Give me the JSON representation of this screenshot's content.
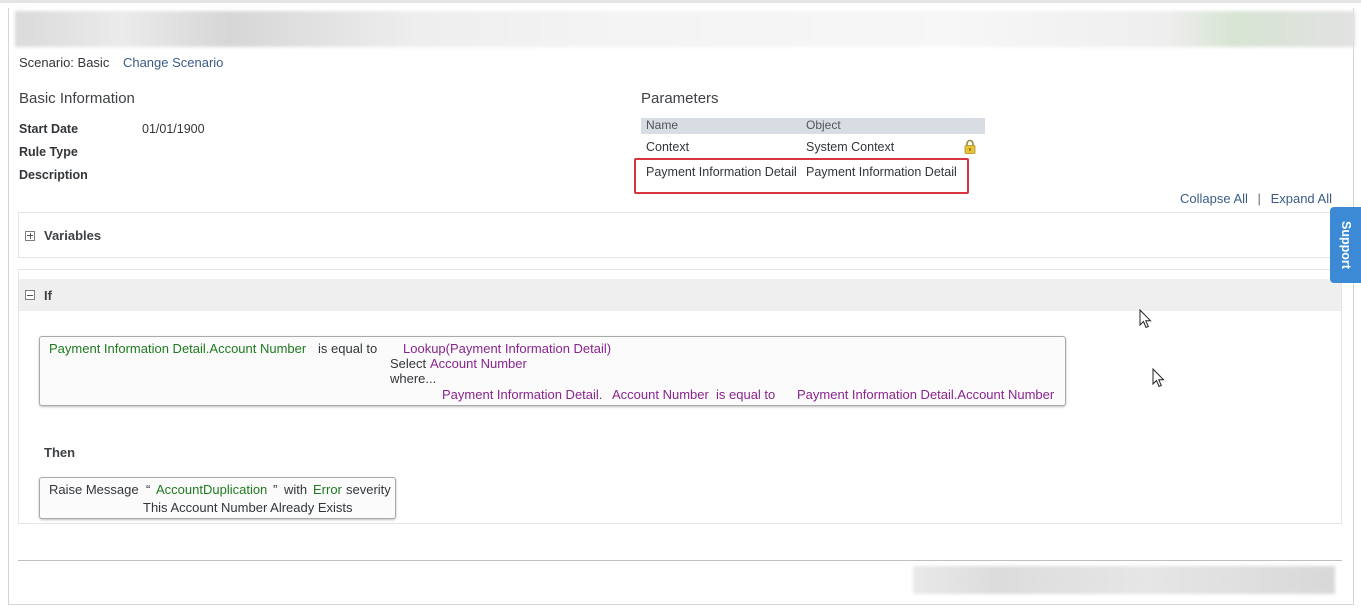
{
  "scenario": {
    "label": "Scenario: Basic",
    "change_link": "Change Scenario"
  },
  "basic_info": {
    "title": "Basic Information",
    "fields": [
      {
        "label": "Start Date",
        "value": "01/01/1900"
      },
      {
        "label": "Rule Type",
        "value": ""
      },
      {
        "label": "Description",
        "value": ""
      }
    ]
  },
  "parameters": {
    "title": "Parameters",
    "columns": [
      "Name",
      "Object"
    ],
    "rows": [
      {
        "name": "Context",
        "object": "System Context",
        "locked": true
      },
      {
        "name": "Payment Information Detail",
        "object": "Payment Information Detail",
        "highlighted": true
      }
    ]
  },
  "toggles": {
    "collapse_all": "Collapse All",
    "separator": "|",
    "expand_all": "Expand All"
  },
  "variables": {
    "title": "Variables"
  },
  "if_section": {
    "title": "If",
    "condition": {
      "left_operand": "Payment Information Detail.Account Number",
      "operator": "is equal to",
      "lookup": "Lookup(Payment Information Detail)",
      "select_keyword": "Select",
      "select_field": "Account Number",
      "where_keyword": "where...",
      "where_object": "Payment Information Detail.",
      "where_field": "Account Number",
      "where_operator": "is equal to",
      "where_value": "Payment Information Detail.Account Number"
    }
  },
  "then_section": {
    "title": "Then",
    "action": {
      "verb": "Raise Message",
      "open_quote": "“",
      "message_key": "AccountDuplication",
      "close_quote": "”",
      "with_word": "with",
      "severity": "Error",
      "severity_word": "severity",
      "message_text": "This Account Number Already Exists"
    }
  },
  "support_tab": {
    "label": "Support"
  },
  "colors": {
    "accent": "#3b5c87",
    "field_green": "#1f7a1f",
    "field_purple": "#8a258f",
    "highlight_red": "#d9343f",
    "support_blue": "#3c8ad6"
  },
  "icons": {
    "lock": "lock-icon",
    "expand": "plus-square-icon",
    "collapse": "minus-square-icon"
  }
}
